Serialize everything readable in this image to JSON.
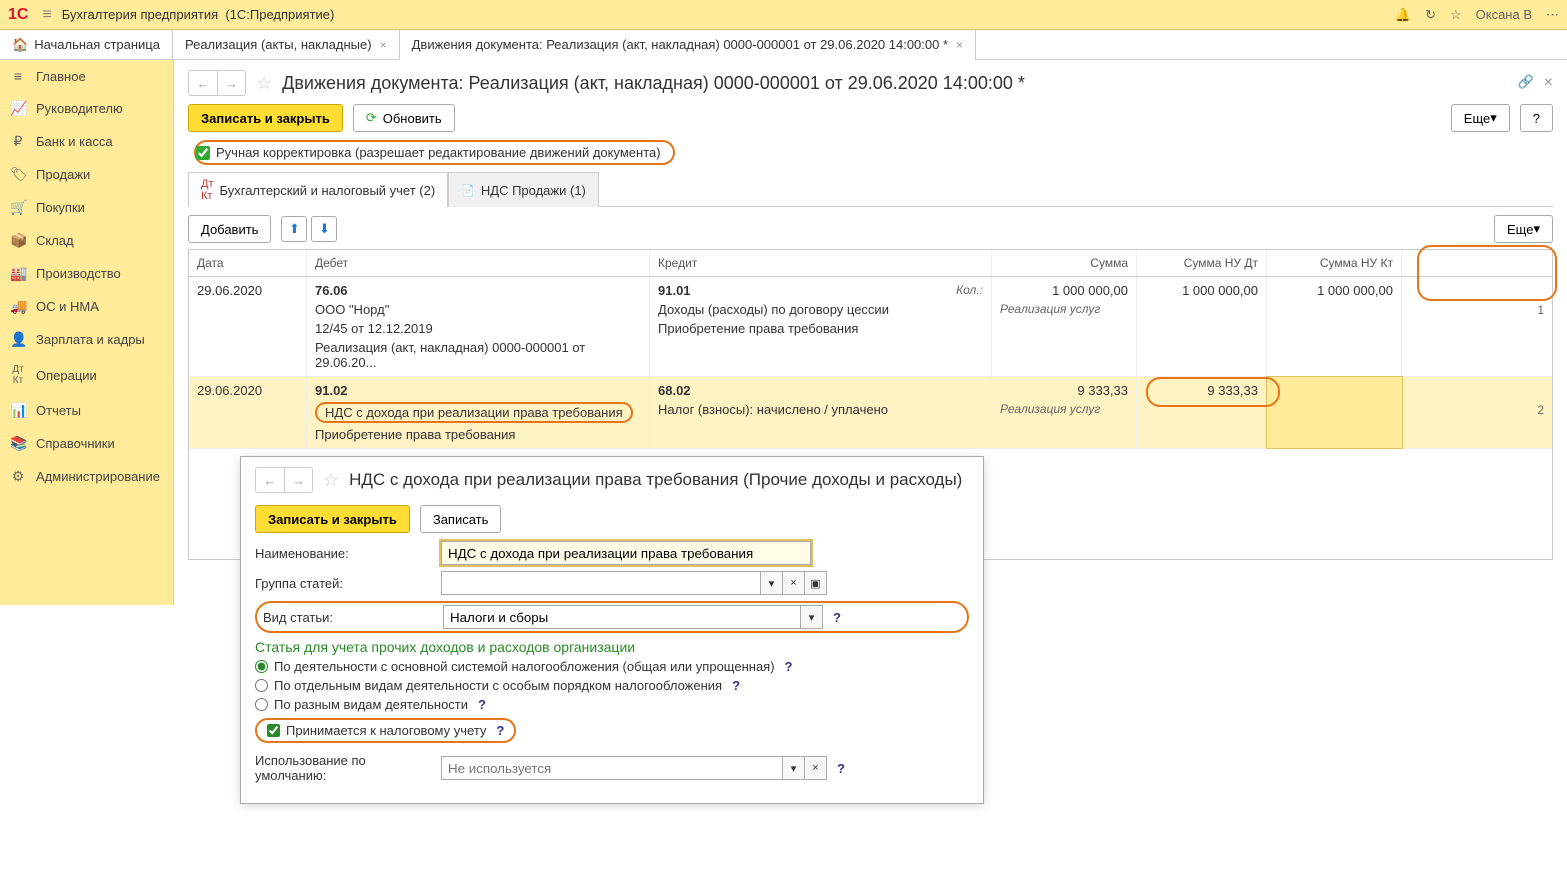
{
  "titlebar": {
    "app": "Бухгалтерия предприятия",
    "platform": "(1С:Предприятие)",
    "user": "Оксана В"
  },
  "tabs": {
    "home": "Начальная страница",
    "t1": "Реализация (акты, накладные)",
    "t2": "Движения документа: Реализация (акт, накладная) 0000-000001 от 29.06.2020 14:00:00 *"
  },
  "sidebar": [
    "Главное",
    "Руководителю",
    "Банк и касса",
    "Продажи",
    "Покупки",
    "Склад",
    "Производство",
    "ОС и НМА",
    "Зарплата и кадры",
    "Операции",
    "Отчеты",
    "Справочники",
    "Администрирование"
  ],
  "content": {
    "title": "Движения документа: Реализация (акт, накладная) 0000-000001 от 29.06.2020 14:00:00 *",
    "save_close": "Записать и закрыть",
    "refresh": "Обновить",
    "more": "Еще",
    "manual": "Ручная корректировка (разрешает редактирование движений документа)",
    "subtabs": {
      "t1": "Бухгалтерский и налоговый учет (2)",
      "t2": "НДС Продажи (1)"
    },
    "add": "Добавить"
  },
  "grid": {
    "hdr": {
      "date": "Дата",
      "debit": "Дебет",
      "credit": "Кредит",
      "sum": "Сумма",
      "sumdt": "Сумма НУ Дт",
      "sumkt": "Сумма НУ Кт"
    },
    "rows": [
      {
        "n": "1",
        "date": "29.06.2020",
        "debit_acc": "76.06",
        "debit_lines": [
          "ООО \"Норд\"",
          "12/45 от 12.12.2019",
          "Реализация (акт, накладная) 0000-000001 от 29.06.20..."
        ],
        "credit_acc": "91.01",
        "credit_kol": "Кол.:",
        "credit_lines": [
          "Доходы (расходы) по договору цессии",
          "Приобретение права требования"
        ],
        "sum": "1 000 000,00",
        "sum_note": "Реализация услуг",
        "sumdt": "1 000 000,00",
        "sumkt": "1 000 000,00"
      },
      {
        "n": "2",
        "date": "29.06.2020",
        "debit_acc": "91.02",
        "debit_lines": [
          "НДС с дохода при реализации права требования",
          "Приобретение права требования"
        ],
        "credit_acc": "68.02",
        "credit_lines": [
          "Налог (взносы): начислено / уплачено"
        ],
        "sum": "9 333,33",
        "sum_note": "Реализация услуг",
        "sumdt": "9 333,33",
        "sumkt": ""
      }
    ]
  },
  "dialog": {
    "title": "НДС с дохода при реализации права требования (Прочие доходы и расходы)",
    "save_close": "Записать и закрыть",
    "save": "Записать",
    "name_lbl": "Наименование:",
    "name_val": "НДС с дохода при реализации права требования",
    "group_lbl": "Группа статей:",
    "kind_lbl": "Вид статьи:",
    "kind_val": "Налоги и сборы",
    "sect_hdr": "Статья для учета прочих доходов и расходов организации",
    "r1": "По деятельности с основной системой налогообложения (общая или упрощенная)",
    "r2": "По отдельным видам деятельности с особым порядком налогообложения",
    "r3": "По разным видам деятельности",
    "chk": "Принимается к налоговому учету",
    "def_lbl": "Использование по умолчанию:",
    "def_ph": "Не используется"
  }
}
